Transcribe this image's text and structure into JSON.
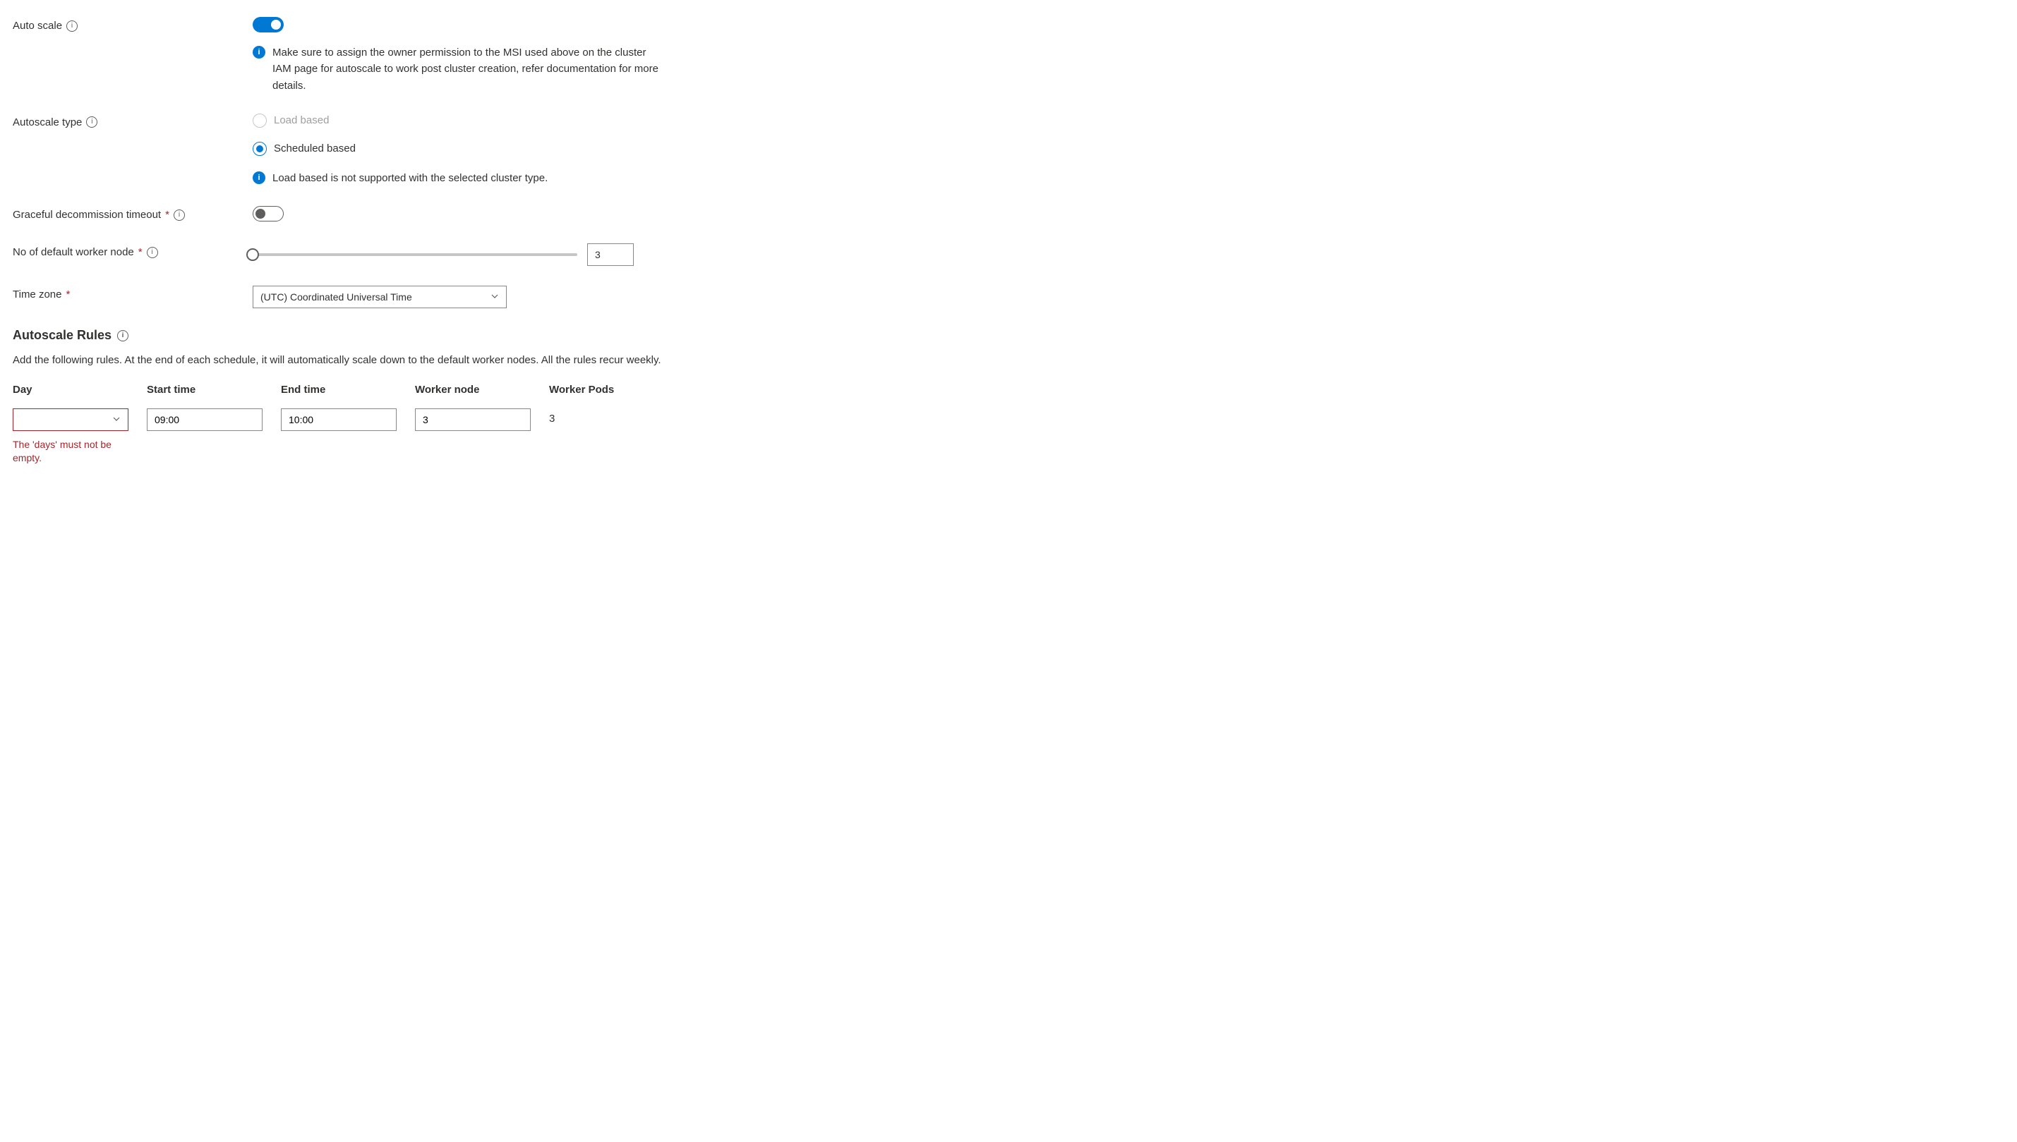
{
  "autoScale": {
    "label": "Auto scale",
    "on": true,
    "banner": "Make sure to assign the owner permission to the MSI used above on the cluster IAM page for autoscale to work post cluster creation, refer documentation for more details."
  },
  "autoscaleType": {
    "label": "Autoscale type",
    "options": {
      "load": "Load based",
      "scheduled": "Scheduled based"
    },
    "note": "Load based is not supported with the selected cluster type."
  },
  "graceful": {
    "label": "Graceful decommission timeout"
  },
  "workerNode": {
    "label": "No of default worker node",
    "value": "3"
  },
  "timezone": {
    "label": "Time zone",
    "value": "(UTC) Coordinated Universal Time"
  },
  "rulesSection": {
    "heading": "Autoscale Rules",
    "desc": "Add the following rules. At the end of each schedule, it will automatically scale down to the default worker nodes. All the rules recur weekly."
  },
  "rulesTable": {
    "headers": {
      "day": "Day",
      "start": "Start time",
      "end": "End time",
      "worker": "Worker node",
      "pods": "Worker Pods"
    },
    "row": {
      "day": "",
      "start": "09:00",
      "end": "10:00",
      "worker": "3",
      "pods": "3"
    },
    "error": "The 'days' must not be empty."
  }
}
